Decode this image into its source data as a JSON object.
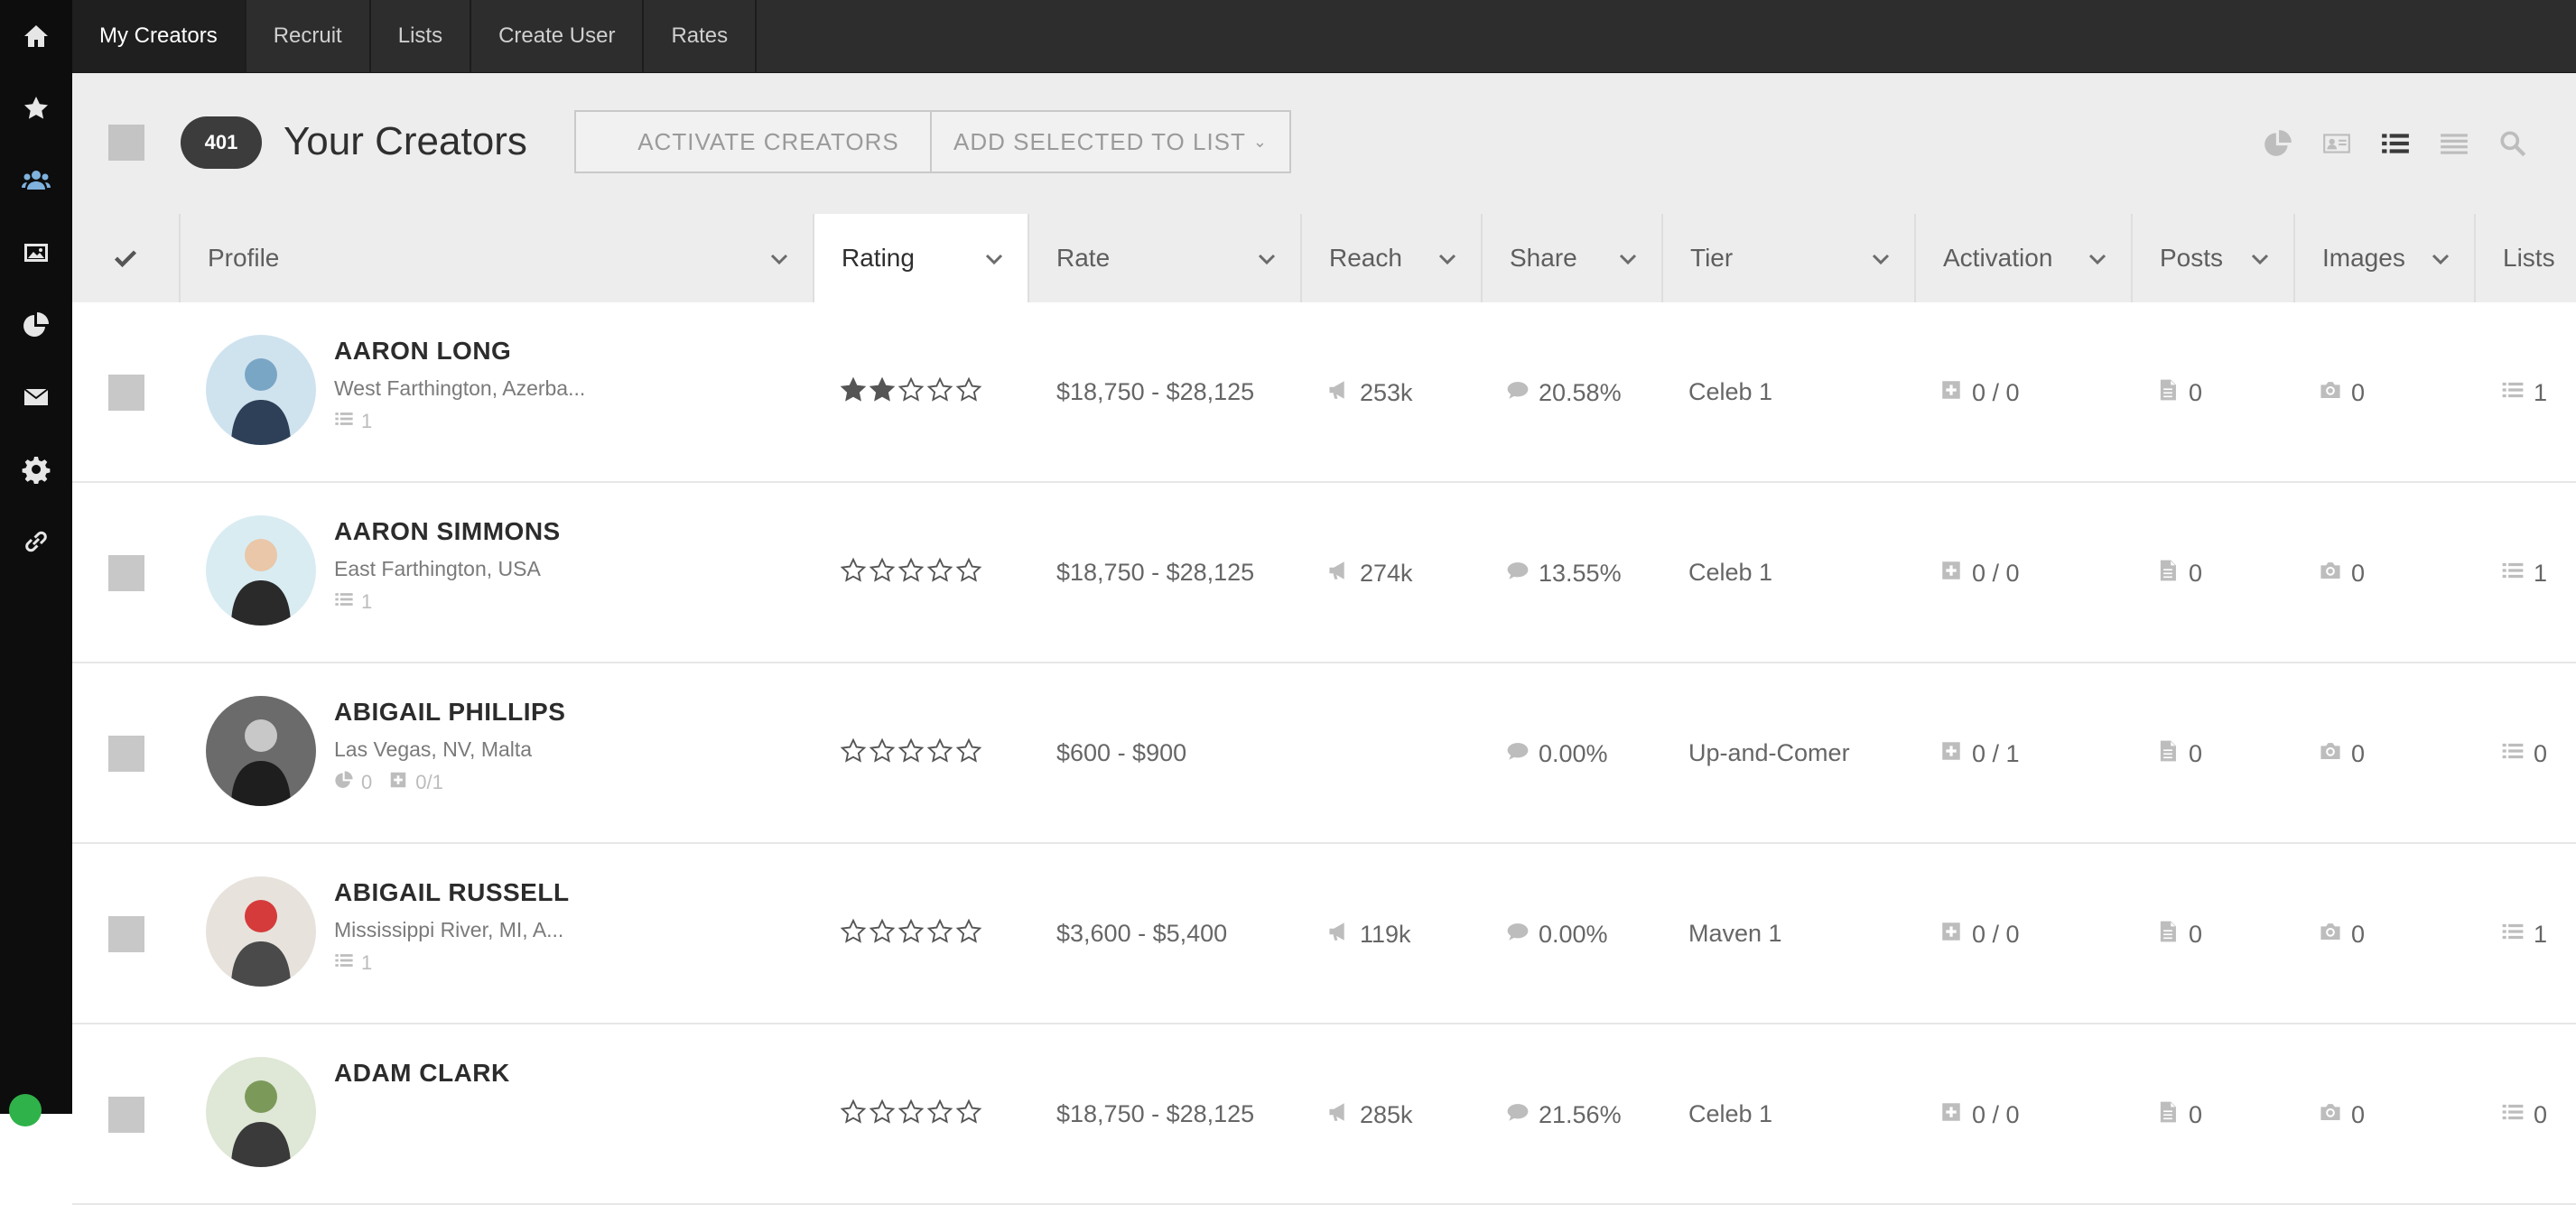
{
  "nav": {
    "tabs": [
      {
        "label": "My Creators"
      },
      {
        "label": "Recruit"
      },
      {
        "label": "Lists"
      },
      {
        "label": "Create User"
      },
      {
        "label": "Rates"
      }
    ]
  },
  "rail": {
    "icons": [
      "home-icon",
      "star-icon",
      "users-icon",
      "image-icon",
      "pie-chart-icon",
      "envelope-icon",
      "gear-icon",
      "link-icon"
    ],
    "active_color": "#7fb2dd"
  },
  "toolbar": {
    "count": "401",
    "title": "Your Creators",
    "activate_label": "ACTIVATE CREATORS",
    "add_to_list_label": "ADD SELECTED TO LIST",
    "view_icons": [
      "pie-chart-icon",
      "id-card-icon",
      "list-view-icon",
      "compact-list-icon",
      "search-icon"
    ]
  },
  "columns": [
    "Profile",
    "Rating",
    "Rate",
    "Reach",
    "Share",
    "Tier",
    "Activation",
    "Posts",
    "Images",
    "Lists"
  ],
  "rows": [
    {
      "name": "AARON LONG",
      "location": "West Farthington, Azerba...",
      "meta": "1",
      "meta_type": "lists",
      "rating": 2,
      "rate": "$18,750 - $28,125",
      "reach": "253k",
      "share": "20.58%",
      "tier": "Celeb 1",
      "activation": "0 / 0",
      "posts": "0",
      "images": "0",
      "lists": "1",
      "lists_icon": "list"
    },
    {
      "name": "AARON SIMMONS",
      "location": "East Farthington, USA",
      "meta": "1",
      "meta_type": "lists",
      "rating": 0,
      "rate": "$18,750 - $28,125",
      "reach": "274k",
      "share": "13.55%",
      "tier": "Celeb 1",
      "activation": "0 / 0",
      "posts": "0",
      "images": "0",
      "lists": "1",
      "lists_icon": "list"
    },
    {
      "name": "ABIGAIL PHILLIPS",
      "location": "Las Vegas, NV, Malta",
      "meta": "0",
      "meta2": "0/1",
      "meta_type": "activity",
      "rating": 0,
      "rate": "$600 - $900",
      "reach": "",
      "share": "0.00%",
      "tier": "Up-and-Comer",
      "activation": "0 / 1",
      "posts": "0",
      "images": "0",
      "lists": "0",
      "lists_icon": "list"
    },
    {
      "name": "ABIGAIL RUSSELL",
      "location": "Mississippi River, MI, A...",
      "meta": "1",
      "meta_type": "lists",
      "rating": 0,
      "rate": "$3,600 - $5,400",
      "reach": "119k",
      "share": "0.00%",
      "tier": "Maven 1",
      "activation": "0 / 0",
      "posts": "0",
      "images": "0",
      "lists": "1",
      "lists_icon": "list"
    },
    {
      "name": "ADAM CLARK",
      "location": "",
      "meta": "",
      "meta_type": "none",
      "rating": 0,
      "rate": "$18,750 - $28,125",
      "reach": "285k",
      "share": "21.56%",
      "tier": "Celeb 1",
      "activation": "0 / 0",
      "posts": "0",
      "images": "0",
      "lists": "0",
      "lists_icon": "list"
    }
  ]
}
